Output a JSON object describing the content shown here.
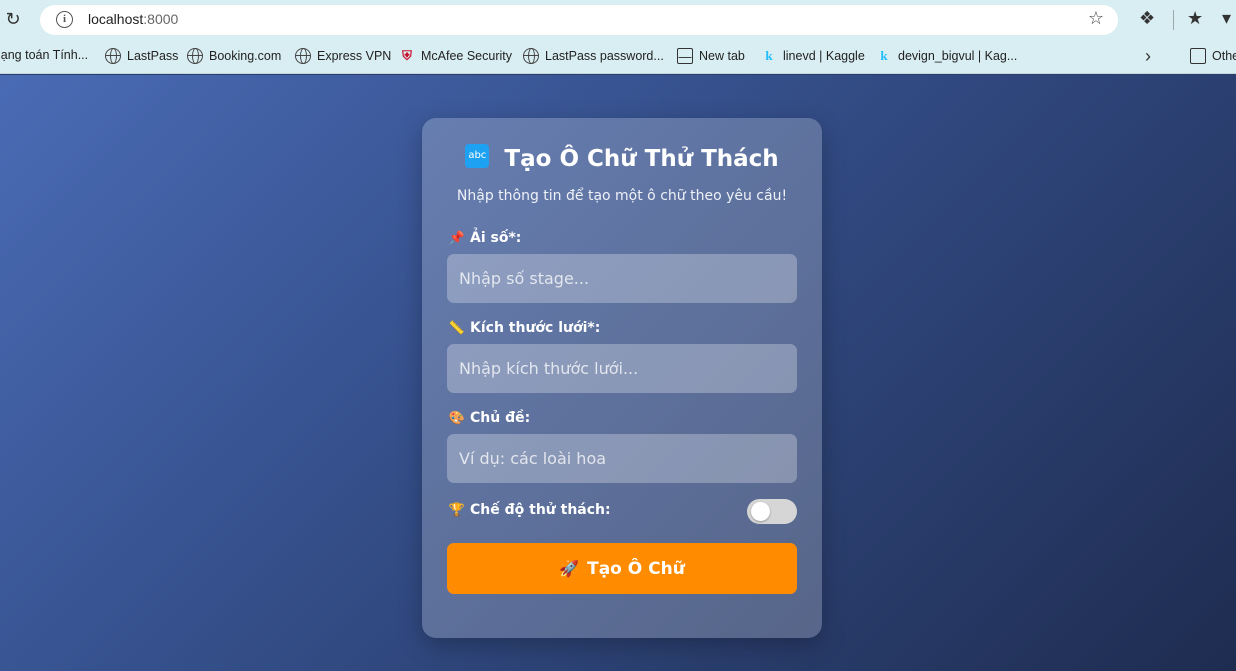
{
  "browser": {
    "url_host": "localhost",
    "url_port": ":8000"
  },
  "bookmarks": [
    {
      "label": "lạng toán Tính...",
      "icon": "none"
    },
    {
      "label": "LastPass",
      "icon": "globe-icon"
    },
    {
      "label": "Booking.com",
      "icon": "globe-icon"
    },
    {
      "label": "Express VPN",
      "icon": "globe-icon"
    },
    {
      "label": "McAfee Security",
      "icon": "mcafee-icon"
    },
    {
      "label": "LastPass password...",
      "icon": "globe-icon"
    },
    {
      "label": "New tab",
      "icon": "tab-icon"
    },
    {
      "label": "linevd | Kaggle",
      "icon": "kaggle-icon"
    },
    {
      "label": "devign_bigvul | Kag...",
      "icon": "kaggle-icon"
    },
    {
      "label": "Othe",
      "icon": "folder-icon"
    }
  ],
  "card": {
    "badge": "abc",
    "title": "Tạo Ô Chữ Thử Thách",
    "subtitle": "Nhập thông tin để tạo một ô chữ theo yêu cầu!",
    "fields": {
      "stage": {
        "emoji": "📌",
        "label": "Ải số*:",
        "placeholder": "Nhập số stage..."
      },
      "grid": {
        "emoji": "📏",
        "label": "Kích thước lưới*:",
        "placeholder": "Nhập kích thước lưới..."
      },
      "topic": {
        "emoji": "🎨",
        "label": "Chủ đề:",
        "placeholder": "Ví dụ: các loài hoa"
      }
    },
    "challenge": {
      "emoji": "🏆",
      "label": "Chế độ thử thách:",
      "enabled": false
    },
    "submit": {
      "emoji": "🚀",
      "label": "Tạo Ô Chữ"
    }
  },
  "colors": {
    "accent": "#ff8c00",
    "badge": "#1da1f2"
  }
}
